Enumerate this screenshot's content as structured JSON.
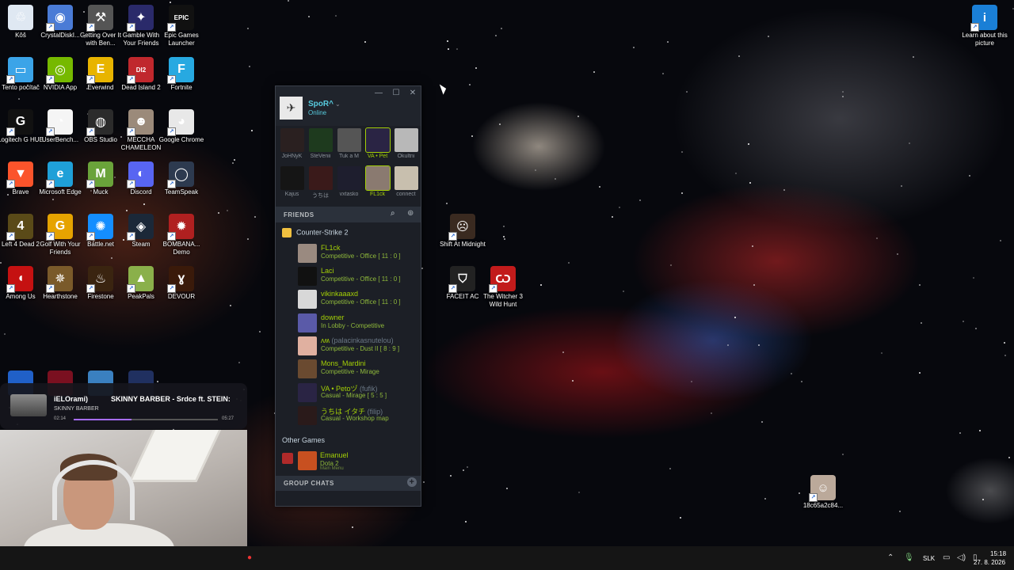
{
  "desktop_icons": [
    {
      "label": "Kôš",
      "color": "#dfe8f2",
      "glyph": "♲"
    },
    {
      "label": "CrystalDiskI...",
      "color": "#4a7bd6",
      "glyph": "◉"
    },
    {
      "label": "Getting Over It with Ben...",
      "color": "#555555",
      "glyph": "⚒"
    },
    {
      "label": "Gamble With Your Friends",
      "color": "#2a2a6a",
      "glyph": "✦"
    },
    {
      "label": "Epic Games Launcher",
      "color": "#111111",
      "glyph": "EPIC"
    },
    {
      "label": "Tento počítač",
      "color": "#3ba4e8",
      "glyph": "▭"
    },
    {
      "label": "NVIDIA App",
      "color": "#76b900",
      "glyph": "◎"
    },
    {
      "label": "Everwind",
      "color": "#e8b400",
      "glyph": "E"
    },
    {
      "label": "Dead Island 2",
      "color": "#c0282d",
      "glyph": "DI2"
    },
    {
      "label": "Fortnite",
      "color": "#27a9e1",
      "glyph": "F"
    },
    {
      "label": "Logitech G HUB",
      "color": "#111111",
      "glyph": "G"
    },
    {
      "label": "UserBench...",
      "color": "#f5f5f5",
      "glyph": "◔"
    },
    {
      "label": "OBS Studio",
      "color": "#2b2b2b",
      "glyph": "◍"
    },
    {
      "label": "MECCHA CHAMELEON",
      "color": "#9b8a7a",
      "glyph": "☻"
    },
    {
      "label": "Google Chrome",
      "color": "#e8e8e8",
      "glyph": "◕"
    },
    {
      "label": "Brave",
      "color": "#fb542b",
      "glyph": "▼"
    },
    {
      "label": "Microsoft Edge",
      "color": "#1fa0d8",
      "glyph": "e"
    },
    {
      "label": "Muck",
      "color": "#6aa33a",
      "glyph": "M"
    },
    {
      "label": "Discord",
      "color": "#5865f2",
      "glyph": "◐"
    },
    {
      "label": "TeamSpeak",
      "color": "#2d3a4f",
      "glyph": "◯"
    },
    {
      "label": "Left 4 Dead 2",
      "color": "#5a4a18",
      "glyph": "4"
    },
    {
      "label": "Golf With Your Friends",
      "color": "#e6a300",
      "glyph": "G"
    },
    {
      "label": "Battle.net",
      "color": "#148eff",
      "glyph": "✺"
    },
    {
      "label": "Steam",
      "color": "#1b2838",
      "glyph": "◈"
    },
    {
      "label": "BOMBANA... Demo",
      "color": "#b02020",
      "glyph": "✹"
    },
    {
      "label": "Among Us",
      "color": "#c51111",
      "glyph": "◖"
    },
    {
      "label": "Hearthstone",
      "color": "#7a5a2a",
      "glyph": "✵"
    },
    {
      "label": "Firestone",
      "color": "#3a2410",
      "glyph": "♨"
    },
    {
      "label": "PeakPals",
      "color": "#8ab04a",
      "glyph": "▲"
    },
    {
      "label": "DEVOUR",
      "color": "#3a1a0a",
      "glyph": "ɣ"
    }
  ],
  "extra_icons": [
    {
      "label": "Shift At Midnight",
      "color": "#3a2a20",
      "glyph": "☹"
    },
    {
      "label": "FACEIT AC",
      "color": "#222222",
      "glyph": "⛉"
    },
    {
      "label": "The Witcher 3 Wild Hunt",
      "color": "#c21b1b",
      "glyph": "Ѡ"
    },
    {
      "label": "Learn about this picture",
      "color": "#1a7fd6",
      "glyph": "i"
    },
    {
      "label": "18c65a2c84...",
      "color": "#bba99a",
      "glyph": "☺"
    }
  ],
  "steam": {
    "username": "SpoR^",
    "status": "Online",
    "recent": [
      {
        "name": "JoHNyK",
        "color": "#2a2020",
        "state": "offline"
      },
      {
        "name": "SteVenii",
        "color": "#1e3a1e",
        "state": "offline"
      },
      {
        "name": "Tuk a M",
        "color": "#555555",
        "state": "offline"
      },
      {
        "name": "VA • Pet",
        "color": "#2a2444",
        "state": "ingame"
      },
      {
        "name": "Okultni",
        "color": "#b8b8b8",
        "state": "offline"
      },
      {
        "name": "Kajus",
        "color": "#151515",
        "state": "offline"
      },
      {
        "name": "うちは",
        "color": "#3a1a1a",
        "state": "offline"
      },
      {
        "name": "vxtasko",
        "color": "#1e1e2e",
        "state": "offline"
      },
      {
        "name": "FL1ck",
        "color": "#8a7a70",
        "state": "ingame"
      },
      {
        "name": "connect",
        "color": "#c8bfae",
        "state": "offline"
      }
    ],
    "friends_header": "FRIENDS",
    "group_name": "Counter-Strike 2",
    "friends": [
      {
        "name": "FL1ck",
        "nick": "",
        "game": "Competitive - Office [ 11 : 0 ]",
        "color": "#9a8a80"
      },
      {
        "name": "Laci",
        "nick": "",
        "game": "Competitive - Office [ 11 : 0 ]",
        "color": "#111111"
      },
      {
        "name": "vikinkaaaxd",
        "nick": "",
        "game": "Competitive - Office [ 11 : 0 ]",
        "color": "#d8d8d8"
      },
      {
        "name": "downer",
        "nick": "",
        "game": "In Lobby - Competitive",
        "color": "#5a5aa8"
      },
      {
        "name": "ʌʍ",
        "nick": "(palacinkasnutelou)",
        "game": "Competitive - Dust II [ 8 : 9 ]",
        "color": "#e0b0a0"
      },
      {
        "name": "Mons_Mardini",
        "nick": "",
        "game": "Competitive - Mirage",
        "color": "#6a4a30"
      },
      {
        "name": "VA • Petoヅ",
        "nick": "(fufik)",
        "game": "Casual - Mirage [ 5 : 5 ]",
        "color": "#2a2444"
      },
      {
        "name": "うちは イタチ",
        "nick": "(filip)",
        "game": "Casual - Workshop map",
        "color": "#2a1a1a"
      }
    ],
    "other_games_header": "Other Games",
    "other_friend": {
      "name": "Emanuel",
      "game": "Dota 2",
      "sub": "Main Menu",
      "color": "#c85020"
    },
    "group_chats_header": "GROUP CHATS"
  },
  "media": {
    "title_left": "iELOrami)",
    "title_right": "SKINNY BARBER - Srdce ft. STEIN:",
    "artist": "SKINNY BARBER",
    "elapsed": "02:14",
    "duration": "05:27",
    "progress": 0.4
  },
  "taskbar": {
    "language": "SLK",
    "time": "15:18",
    "date": "27. 8. 2026"
  }
}
